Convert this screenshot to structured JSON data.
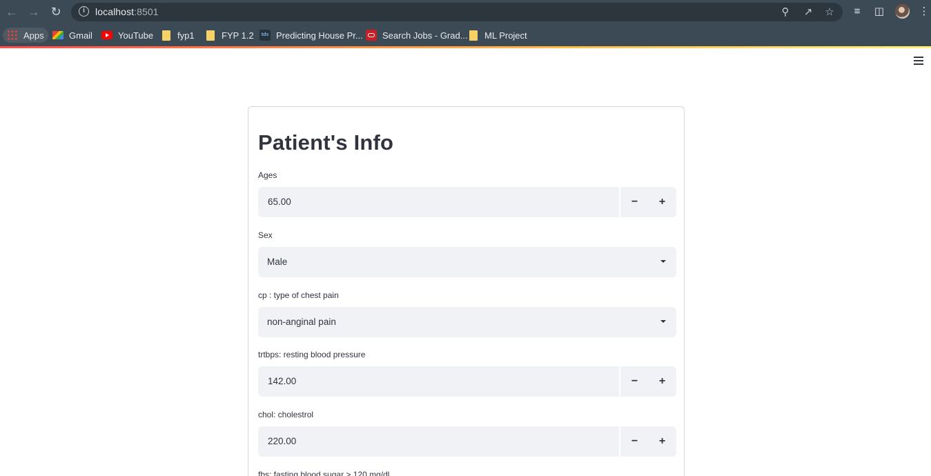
{
  "browser": {
    "url_host": "localhost",
    "url_port": ":8501",
    "bookmarks": [
      {
        "label": "Apps",
        "icon": "apps-grid-icon"
      },
      {
        "label": "Gmail",
        "icon": "gmail-icon"
      },
      {
        "label": "YouTube",
        "icon": "youtube-icon"
      },
      {
        "label": "fyp1",
        "icon": "folder-icon"
      },
      {
        "label": "FYP 1.2",
        "icon": "folder-icon"
      },
      {
        "label": "Predicting House Pr...",
        "icon": "tds-icon"
      },
      {
        "label": "Search Jobs - Grad...",
        "icon": "oracle-icon"
      },
      {
        "label": "ML Project",
        "icon": "folder-icon"
      }
    ],
    "tds_icon_text": "tds"
  },
  "form": {
    "title": "Patient's Info",
    "fields": [
      {
        "label": "Ages",
        "type": "number",
        "value": "65.00"
      },
      {
        "label": "Sex",
        "type": "select",
        "value": "Male"
      },
      {
        "label": "cp : type of chest pain",
        "type": "select",
        "value": "non-anginal pain"
      },
      {
        "label": "trtbps: resting blood pressure",
        "type": "number",
        "value": "142.00"
      },
      {
        "label": "chol: cholestrol",
        "type": "number",
        "value": "220.00"
      },
      {
        "label": "fbs: fasting blood sugar > 120 mg/dl",
        "type": "select",
        "value": ""
      }
    ],
    "stepper": {
      "minus": "−",
      "plus": "+"
    }
  },
  "colors": {
    "chrome": "#3c4a55",
    "input_bg": "#f0f2f6",
    "text": "#31333f",
    "accent_start": "#ff4b4b",
    "accent_end": "#fff27a"
  }
}
